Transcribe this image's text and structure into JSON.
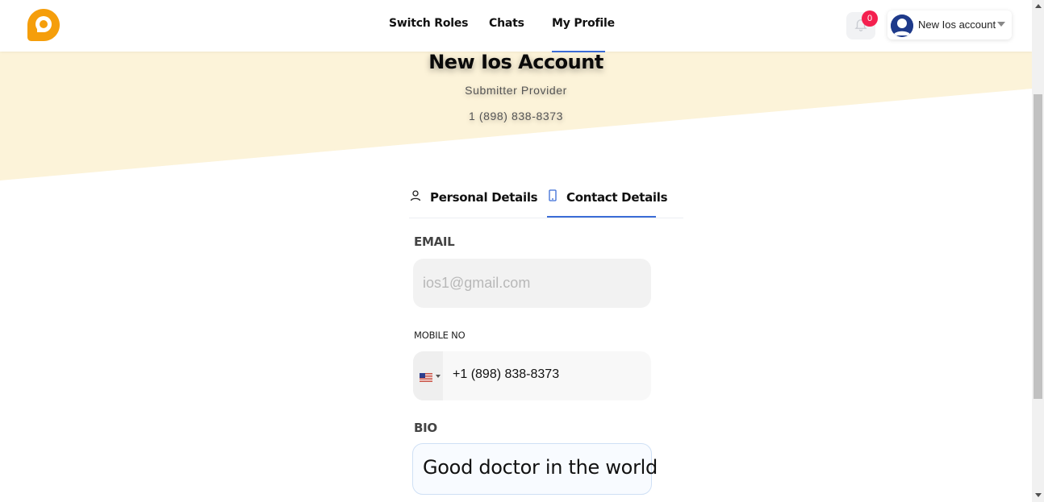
{
  "colors": {
    "accent": "#3b6cd6",
    "brand_orange": "#f59e0b",
    "hero_bg": "#fcf3d9",
    "badge_red": "#f4204f"
  },
  "navbar": {
    "logo_icon": "chat-bubble-logo-icon",
    "links": [
      {
        "label": "Switch Roles"
      },
      {
        "label": "Chats"
      },
      {
        "label": "My Profile",
        "active": true
      }
    ],
    "notifications": {
      "icon": "bell-icon",
      "count": "0"
    },
    "account": {
      "name": "New Ios account",
      "icon": "user-avatar-icon"
    }
  },
  "profile": {
    "name": "New Ios Account",
    "role": "Submitter Provider",
    "phone": "1 (898) 838-8373"
  },
  "tabs": [
    {
      "label": "Personal Details",
      "icon": "user-outline-icon",
      "active": false
    },
    {
      "label": "Contact Details",
      "icon": "mobile-phone-icon",
      "active": true
    }
  ],
  "form": {
    "email": {
      "label": "EMAIL",
      "placeholder": "ios1@gmail.com",
      "value": ""
    },
    "mobile": {
      "label": "MOBILE NO",
      "country": "us-flag-icon",
      "value": "+1 (898) 838-8373"
    },
    "bio": {
      "label": "BIO",
      "value": "Good doctor in the world"
    }
  }
}
